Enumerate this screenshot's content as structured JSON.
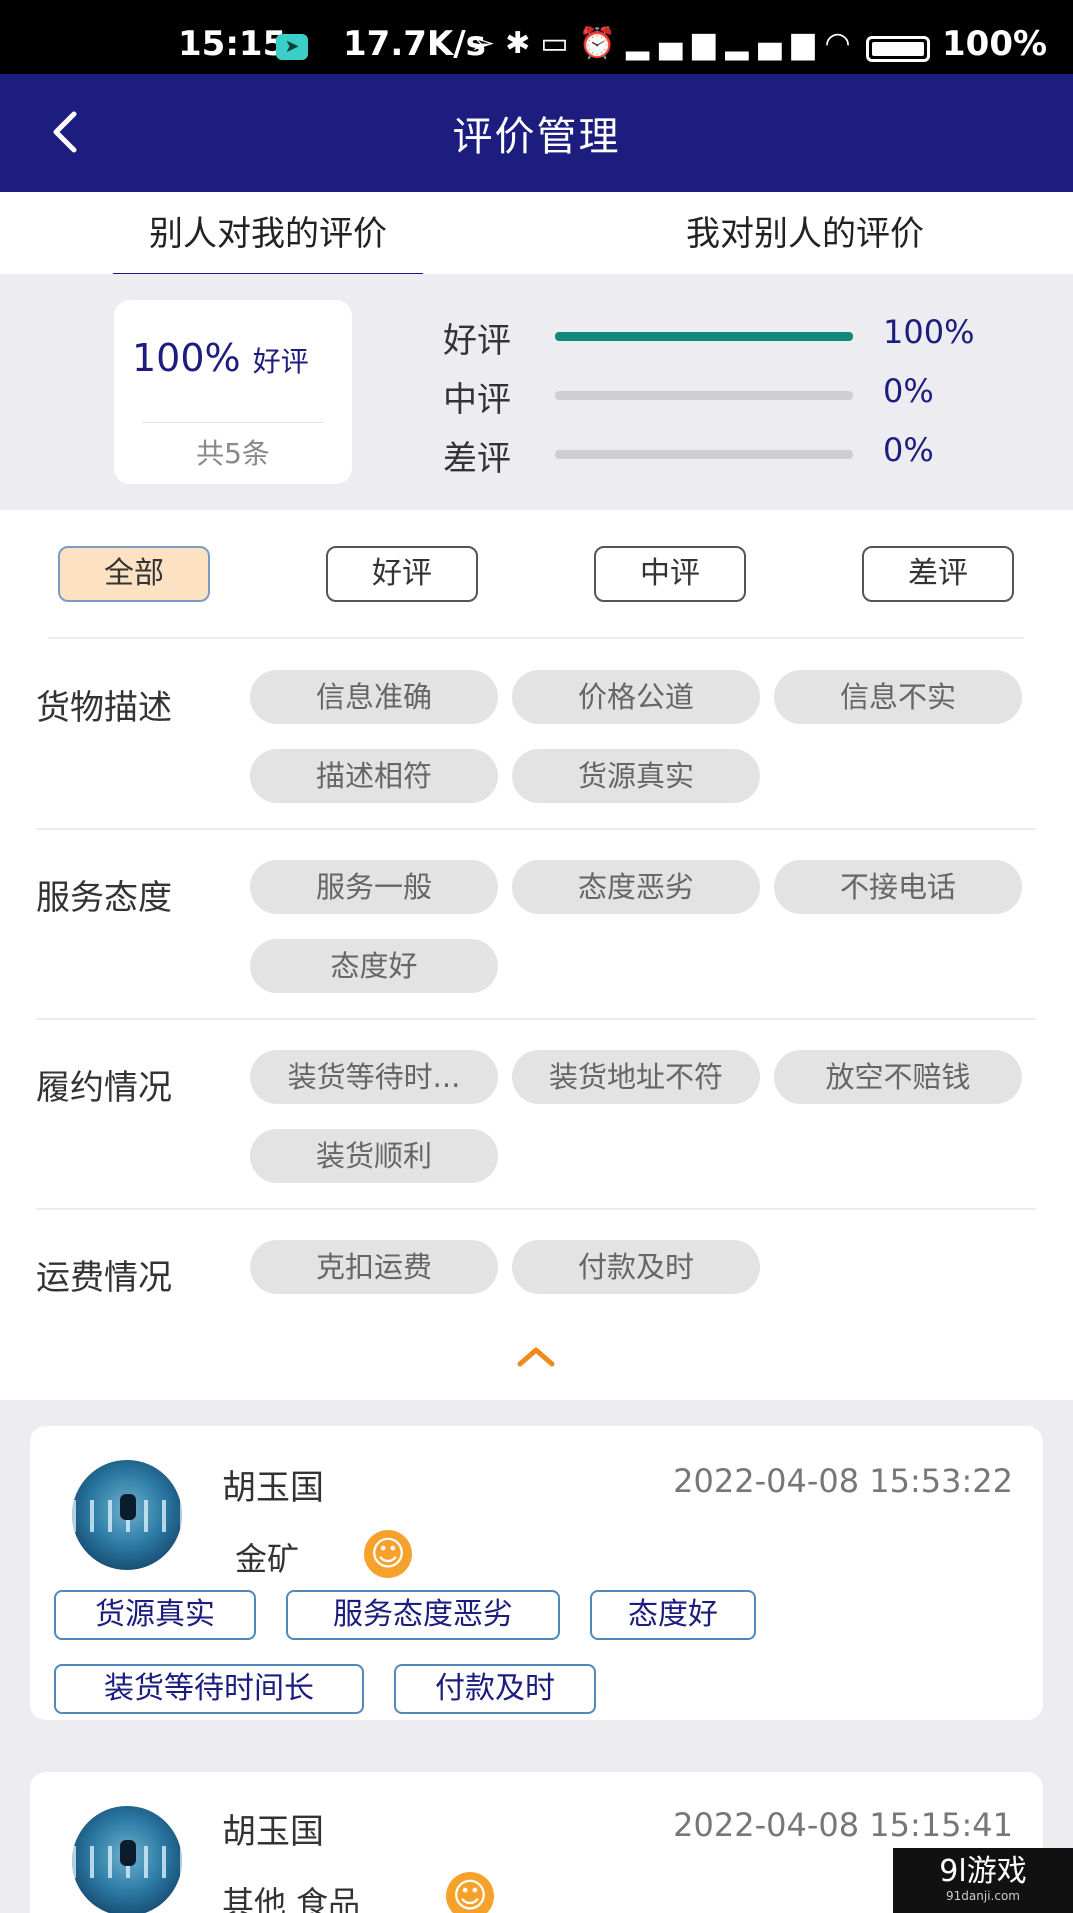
{
  "status_bar": {
    "time": "15:15",
    "network_speed": "17.7K/s",
    "battery_level": "100%",
    "icons": [
      "location-icon",
      "bluetooth-icon",
      "vibrate-icon",
      "alarm-icon",
      "signal-hd-icon",
      "signal-hd-icon",
      "wifi-icon",
      "battery-icon"
    ]
  },
  "header": {
    "title": "评价管理",
    "back_icon": "chevron-left-icon"
  },
  "tabs": [
    {
      "label": "别人对我的评价",
      "active": true
    },
    {
      "label": "我对别人的评价",
      "active": false
    }
  ],
  "summary": {
    "percent": "100%",
    "percent_label": "好评",
    "total": "共5条",
    "ratings": [
      {
        "label": "好评",
        "value": "100%",
        "fill": 1.0,
        "color": "#0f8779"
      },
      {
        "label": "中评",
        "value": "0%",
        "fill": 0.0,
        "color": "#cfcfd3"
      },
      {
        "label": "差评",
        "value": "0%",
        "fill": 0.0,
        "color": "#cfcfd3"
      }
    ]
  },
  "filters": [
    {
      "label": "全部",
      "active": true
    },
    {
      "label": "好评",
      "active": false
    },
    {
      "label": "中评",
      "active": false
    },
    {
      "label": "差评",
      "active": false
    }
  ],
  "categories": [
    {
      "name": "货物描述",
      "tags": [
        "信息准确",
        "价格公道",
        "信息不实",
        "描述相符",
        "货源真实"
      ]
    },
    {
      "name": "服务态度",
      "tags": [
        "服务一般",
        "态度恶劣",
        "不接电话",
        "态度好"
      ]
    },
    {
      "name": "履约情况",
      "tags": [
        "装货等待时...",
        "装货地址不符",
        "放空不赔钱",
        "装货顺利"
      ]
    },
    {
      "name": "运费情况",
      "tags": [
        "克扣运费",
        "付款及时"
      ]
    }
  ],
  "collapse_icon": "chevron-up-icon",
  "reviews": [
    {
      "name": "胡玉国",
      "time": "2022-04-08 15:53:22",
      "goods": "金矿",
      "face_icon": "smile-icon",
      "tags": [
        "货源真实",
        "服务态度恶劣",
        "态度好",
        "装货等待时间长",
        "付款及时"
      ]
    },
    {
      "name": "胡玉国",
      "time": "2022-04-08 15:15:41",
      "goods": "其他 食品",
      "face_icon": "smile-icon",
      "tags": []
    }
  ],
  "watermark": {
    "text": "9l游戏",
    "sub": "91danji.com"
  },
  "colors": {
    "brand": "#1d1d7f",
    "good_bar": "#0f8779",
    "accent": "#f08a1c"
  }
}
